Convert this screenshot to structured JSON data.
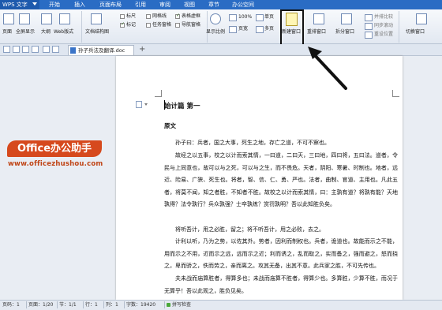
{
  "titlebar": {
    "app_name": "WPS 文字",
    "menus": [
      "开始",
      "插入",
      "页面布局",
      "引用",
      "审阅",
      "视图",
      "章节",
      "办公空间"
    ]
  },
  "ribbon": {
    "page_view": "页面",
    "fullscreen": "全屏显示",
    "outline": "大纲",
    "web_layout": "Web版式",
    "doc_structure": "文档结构图",
    "ruler": "标尺",
    "gridlines": "网格线",
    "table_gridlines": "表格虚框",
    "markup": "标记",
    "task_pane": "任务窗格",
    "nav_pane": "导航窗格",
    "zoom_ratio": "显示比例",
    "zoom_value": "100%",
    "single_page": "单页",
    "multi_page": "多页",
    "page_width": "页宽",
    "new_window": "新建窗口",
    "arrange_windows": "重排窗口",
    "split_window": "拆分窗口",
    "side_by_side": "并排比较",
    "sync_scroll": "同步滚动",
    "reset_position": "重设位置",
    "switch_window": "切换窗口"
  },
  "tabbar": {
    "doc_name": "孙子兵法及翻译.doc",
    "add": "+"
  },
  "document": {
    "title": "始计篇 第一",
    "subhead": "原文",
    "paragraphs": [
      "孙子曰：兵者，国之大事，死生之地，存亡之道，不可不察也。",
      "故经之以五事，校之以计而索其情，一曰道，二曰天，三曰地，四曰将，五曰法。道者，令民与上同意也，故可以与之死，可以与之生，而不畏危。天者，阴阳、寒暑、时制也。地者，远近、险易、广狭、死生也。将者，智、信、仁、勇、严也。法者，曲制、官道、主用也。凡此五者，将莫不闻，知之者胜，不知者不胜。故校之以计而索其情，曰：主孰有道？将孰有能？天地孰得？法令孰行？兵众孰强？士卒孰练？赏罚孰明？吾以此知胜负矣。",
      "将听吾计，用之必胜，留之；将不听吾计，用之必败，去之。",
      "计利以听，乃为之势，以佐其外。势者，因利而制权也。兵者，诡道也。故能而示之不能，用而示之不用，近而示之远，远而示之近；利而诱之，乱而取之，实而备之，强而避之，怒而挠之，卑而骄之，佚而劳之，亲而离之。攻其无备，出其不意。此兵家之胜，不可先传也。",
      "夫未战而庙算胜者，得算多也；未战而庙算不胜者，得算少也。多算胜，少算不胜，而况于无算乎！吾以此观之，胜负见矣。"
    ]
  },
  "watermark": {
    "badge": "Office办公助手",
    "url": "www.officezhushou.com"
  },
  "statusbar": {
    "page_num": "页码：1",
    "pages": "页面：1/20",
    "section": "节：1/1",
    "row": "行：1",
    "col": "列：1",
    "word_count": "字数：19420",
    "spell_check": "拼写检查"
  },
  "colors": {
    "titlebar": "#2a6cc4",
    "watermark_badge": "#d6491d",
    "watermark_url": "#c04516",
    "highlight_box": "#111111"
  }
}
